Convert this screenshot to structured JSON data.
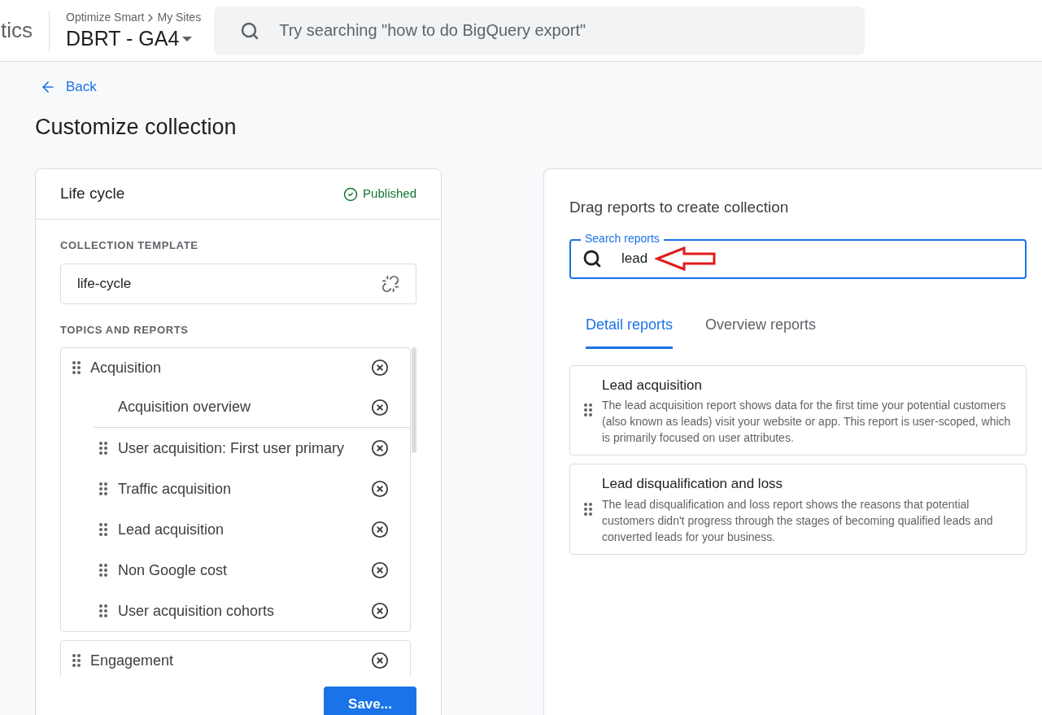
{
  "header": {
    "app_name": "tics",
    "breadcrumb": [
      "Optimize Smart",
      "My Sites"
    ],
    "property": "DBRT - GA4",
    "search": {
      "placeholder": "Try searching \"how to do BigQuery export\""
    }
  },
  "back_link": "Back",
  "page_title": "Customize collection",
  "collection": {
    "name": "Life cycle",
    "status": "Published",
    "template_label": "COLLECTION TEMPLATE",
    "template": "life-cycle",
    "topics_label": "TOPICS AND REPORTS",
    "topics": [
      {
        "name": "Acquisition",
        "reports": [
          {
            "name": "Acquisition overview",
            "draggable": false
          },
          {
            "name": "User acquisition: First user primary",
            "draggable": true
          },
          {
            "name": "Traffic acquisition",
            "draggable": true
          },
          {
            "name": "Lead acquisition",
            "draggable": true
          },
          {
            "name": "Non Google cost",
            "draggable": true
          },
          {
            "name": "User acquisition cohorts",
            "draggable": true
          }
        ]
      },
      {
        "name": "Engagement"
      }
    ],
    "save_button": "Save..."
  },
  "library": {
    "title": "Drag reports to create collection",
    "search": {
      "label": "Search reports",
      "value": "lead"
    },
    "tabs": [
      {
        "label": "Detail reports",
        "selected": true
      },
      {
        "label": "Overview reports",
        "selected": false
      }
    ],
    "results": [
      {
        "title": "Lead acquisition",
        "description": "The lead acquisition report shows data for the first time your potential customers (also known as leads) visit your website or app. This report is user-scoped, which is primarily focused on user attributes."
      },
      {
        "title": "Lead disqualification and loss",
        "description": "The lead disqualification and loss report shows the reasons that potential customers didn't progress through the stages of becoming qualified leads and converted leads for your business."
      }
    ]
  }
}
